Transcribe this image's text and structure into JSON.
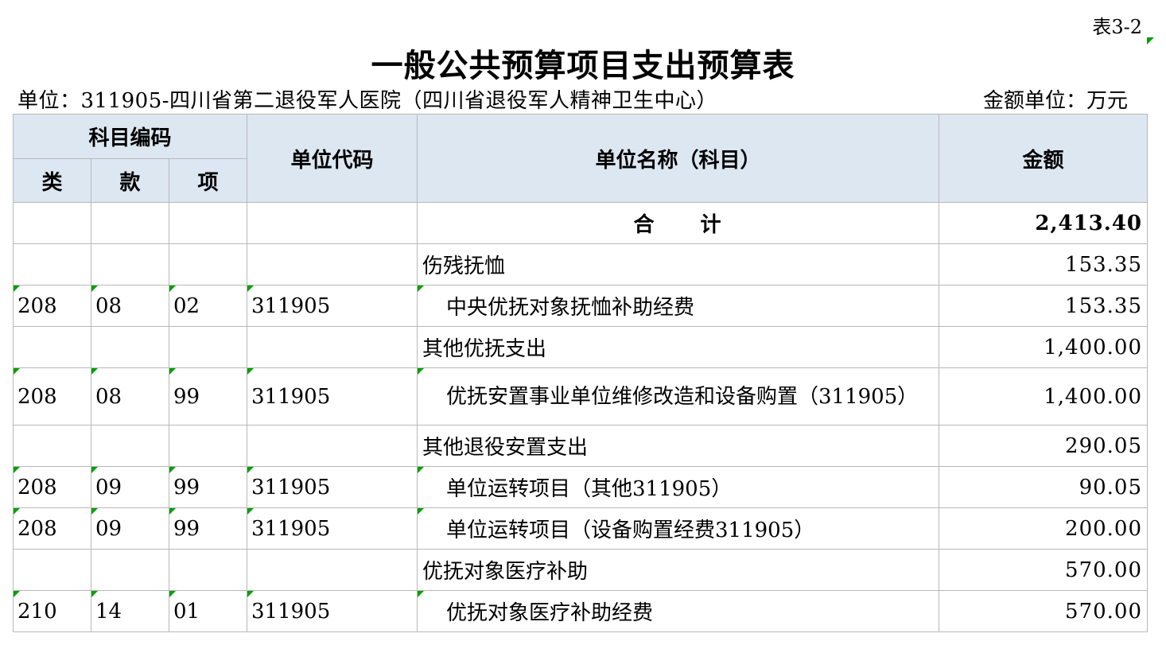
{
  "table_no": "表3-2",
  "title": "一般公共预算项目支出预算表",
  "unit_label": "单位：311905-四川省第二退役军人医院（四川省退役军人精神卫生中心）",
  "money_unit_label": "金额单位：万元",
  "headers": {
    "subject_code": "科目编码",
    "lei": "类",
    "kuan": "款",
    "xiang": "项",
    "unit_code": "单位代码",
    "unit_name": "单位名称（科目）",
    "amount": "金额"
  },
  "total": {
    "label": "合　　计",
    "amount": "2,413.40"
  },
  "rows": [
    {
      "lei": "",
      "kuan": "",
      "xiang": "",
      "code": "",
      "name": "伤残抚恤",
      "amount": "153.35"
    },
    {
      "lei": "208",
      "kuan": "08",
      "xiang": "02",
      "code": "311905",
      "name": "中央优抚对象抚恤补助经费",
      "amount": "153.35"
    },
    {
      "lei": "",
      "kuan": "",
      "xiang": "",
      "code": "",
      "name": "其他优抚支出",
      "amount": "1,400.00"
    },
    {
      "lei": "208",
      "kuan": "08",
      "xiang": "99",
      "code": "311905",
      "name": "优抚安置事业单位维修改造和设备购置（311905）",
      "amount": "1,400.00"
    },
    {
      "lei": "",
      "kuan": "",
      "xiang": "",
      "code": "",
      "name": "其他退役安置支出",
      "amount": "290.05"
    },
    {
      "lei": "208",
      "kuan": "09",
      "xiang": "99",
      "code": "311905",
      "name": "单位运转项目（其他311905）",
      "amount": "90.05"
    },
    {
      "lei": "208",
      "kuan": "09",
      "xiang": "99",
      "code": "311905",
      "name": "单位运转项目（设备购置经费311905）",
      "amount": "200.00"
    },
    {
      "lei": "",
      "kuan": "",
      "xiang": "",
      "code": "",
      "name": "优抚对象医疗补助",
      "amount": "570.00"
    },
    {
      "lei": "210",
      "kuan": "14",
      "xiang": "01",
      "code": "311905",
      "name": "优抚对象医疗补助经费",
      "amount": "570.00"
    }
  ]
}
